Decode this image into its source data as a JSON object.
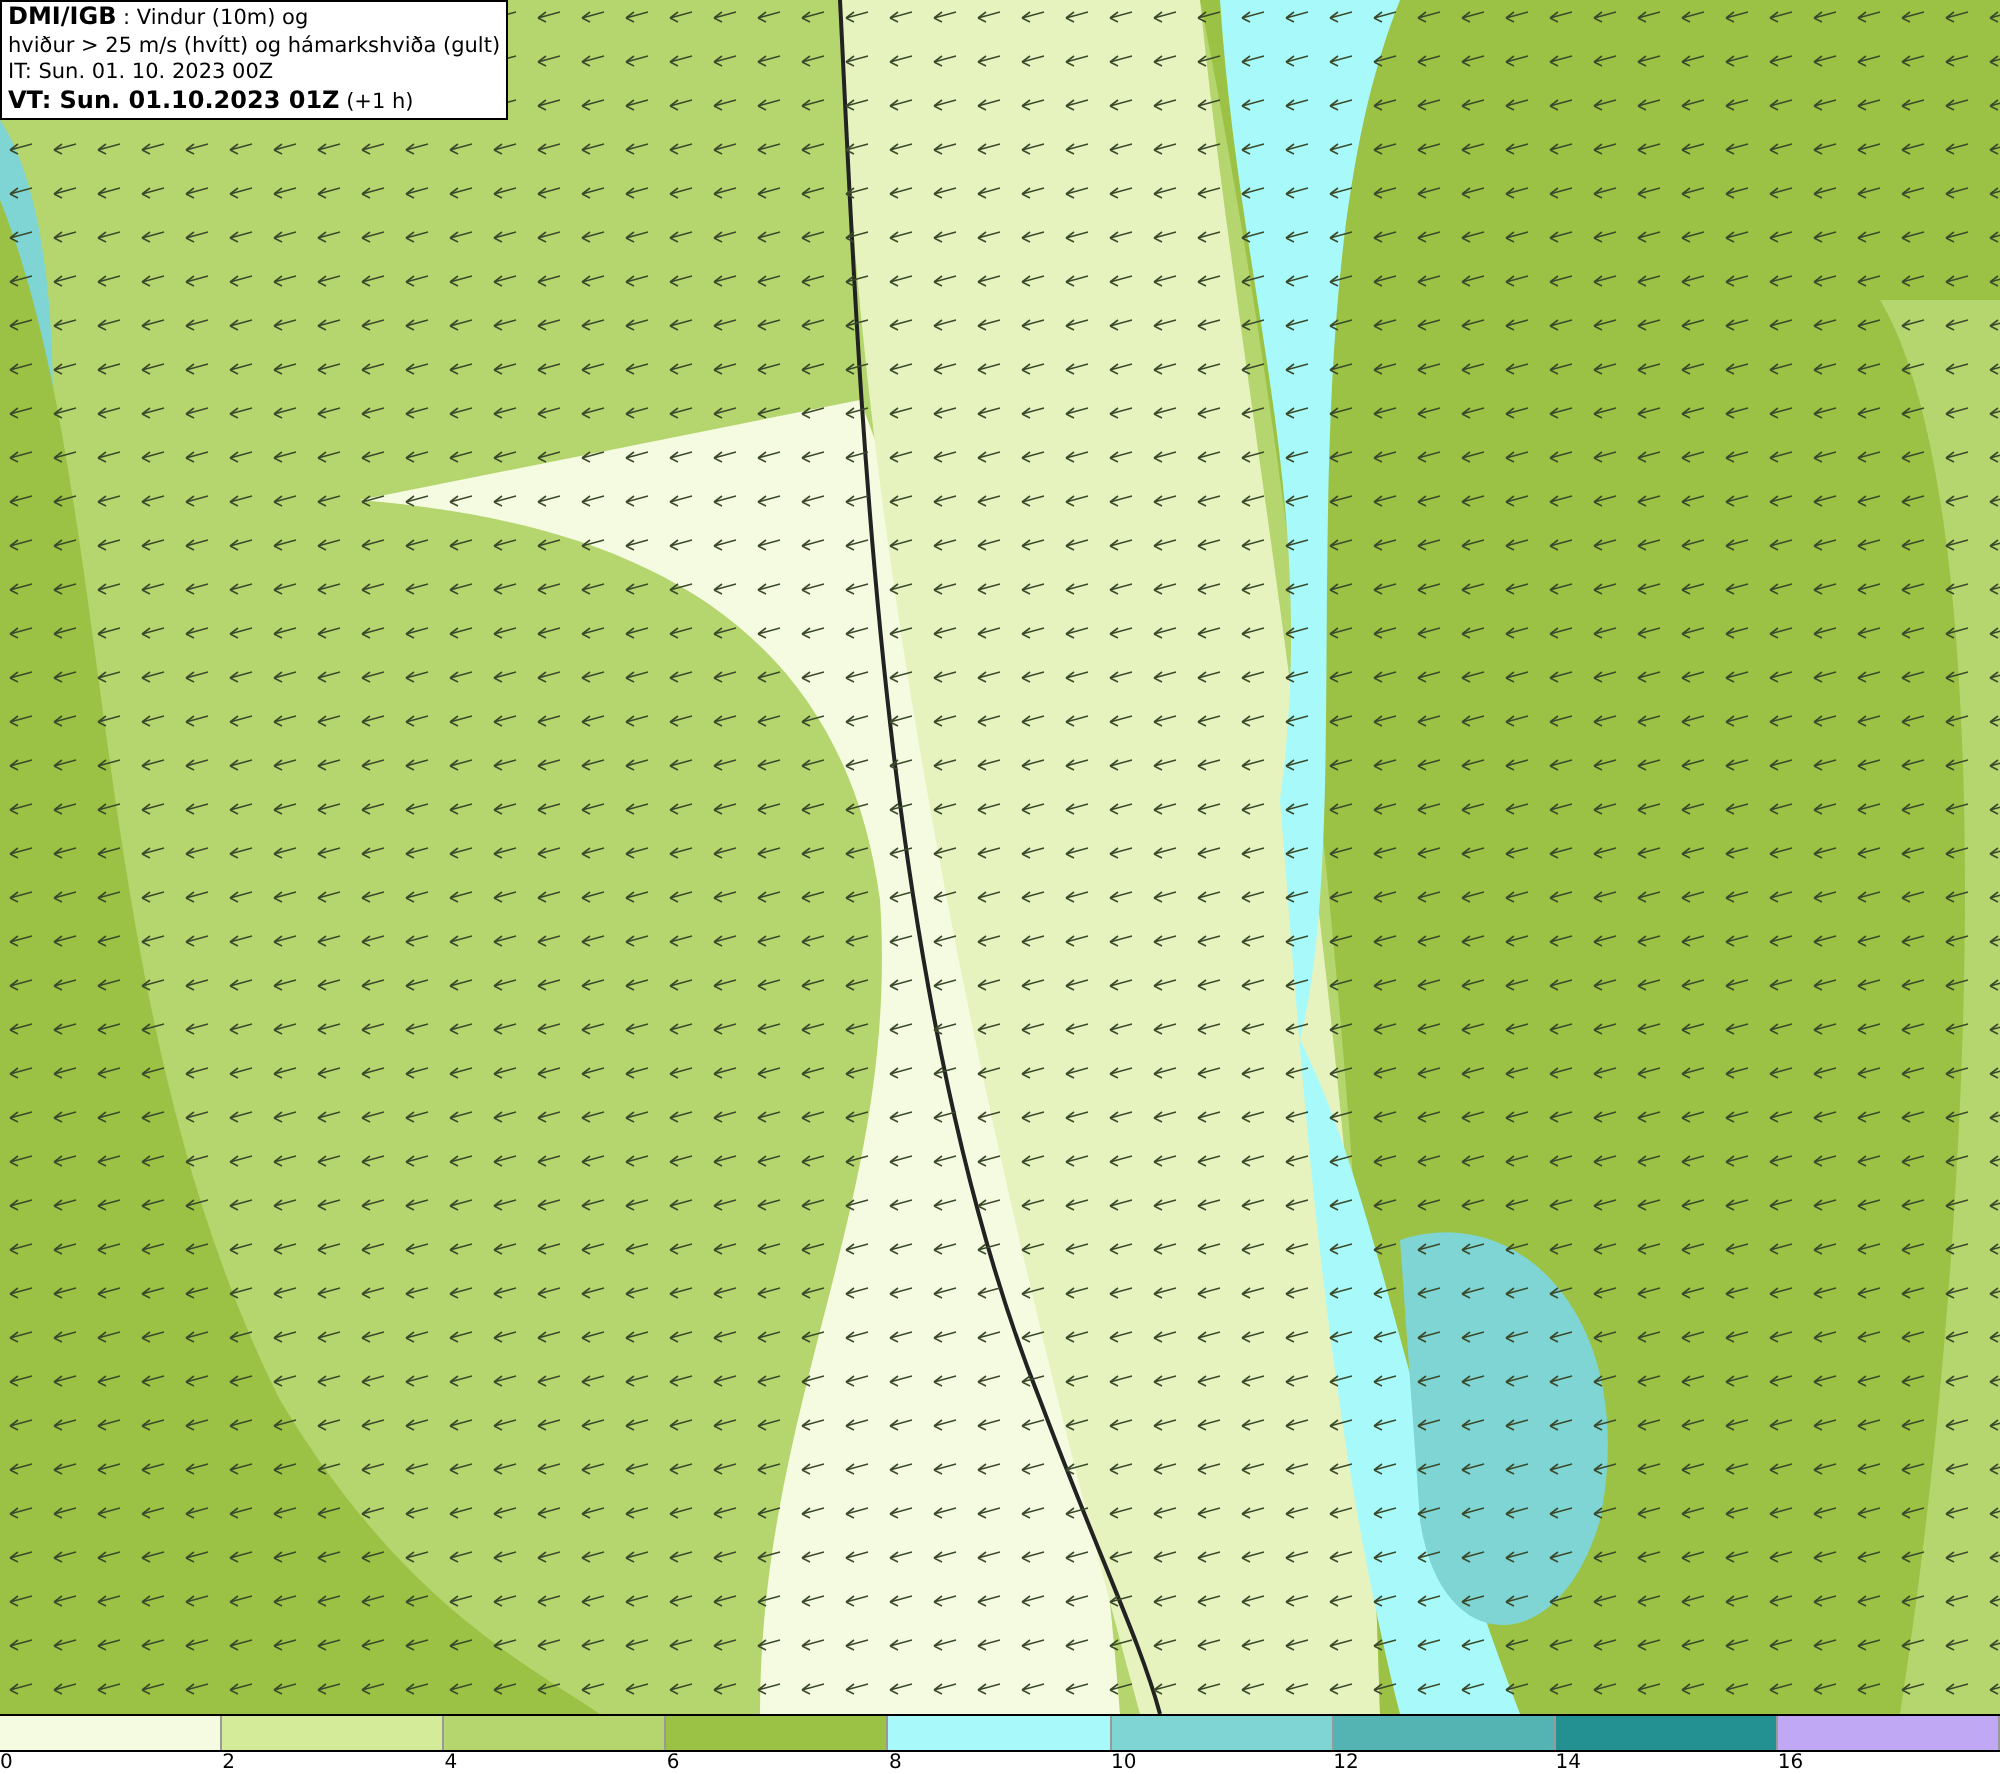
{
  "title_box": {
    "lines": [
      "**DMI/IGB** : Vindur (10m) og",
      "hviður > 25 m/s (hvítt) og hámarkshviða (gult)",
      "IT: Sun. 01. 10. 2023 00Z",
      "**VT: Sun. 01.10.2023 01Z** (+1 h)"
    ]
  },
  "legend": {
    "bins": [
      {
        "color": "#f5fbe0"
      },
      {
        "color": "#d4ec9a"
      },
      {
        "color": "#b5d66e"
      },
      {
        "color": "#9cc245"
      },
      {
        "color": "#a8fafa"
      },
      {
        "color": "#7fd4d4"
      },
      {
        "color": "#54b3b3"
      },
      {
        "color": "#239191"
      },
      {
        "color": "#c0a8f4"
      }
    ],
    "ticks": [
      "0",
      "2",
      "4",
      "6",
      "8",
      "10",
      "12",
      "14",
      "16"
    ]
  }
}
